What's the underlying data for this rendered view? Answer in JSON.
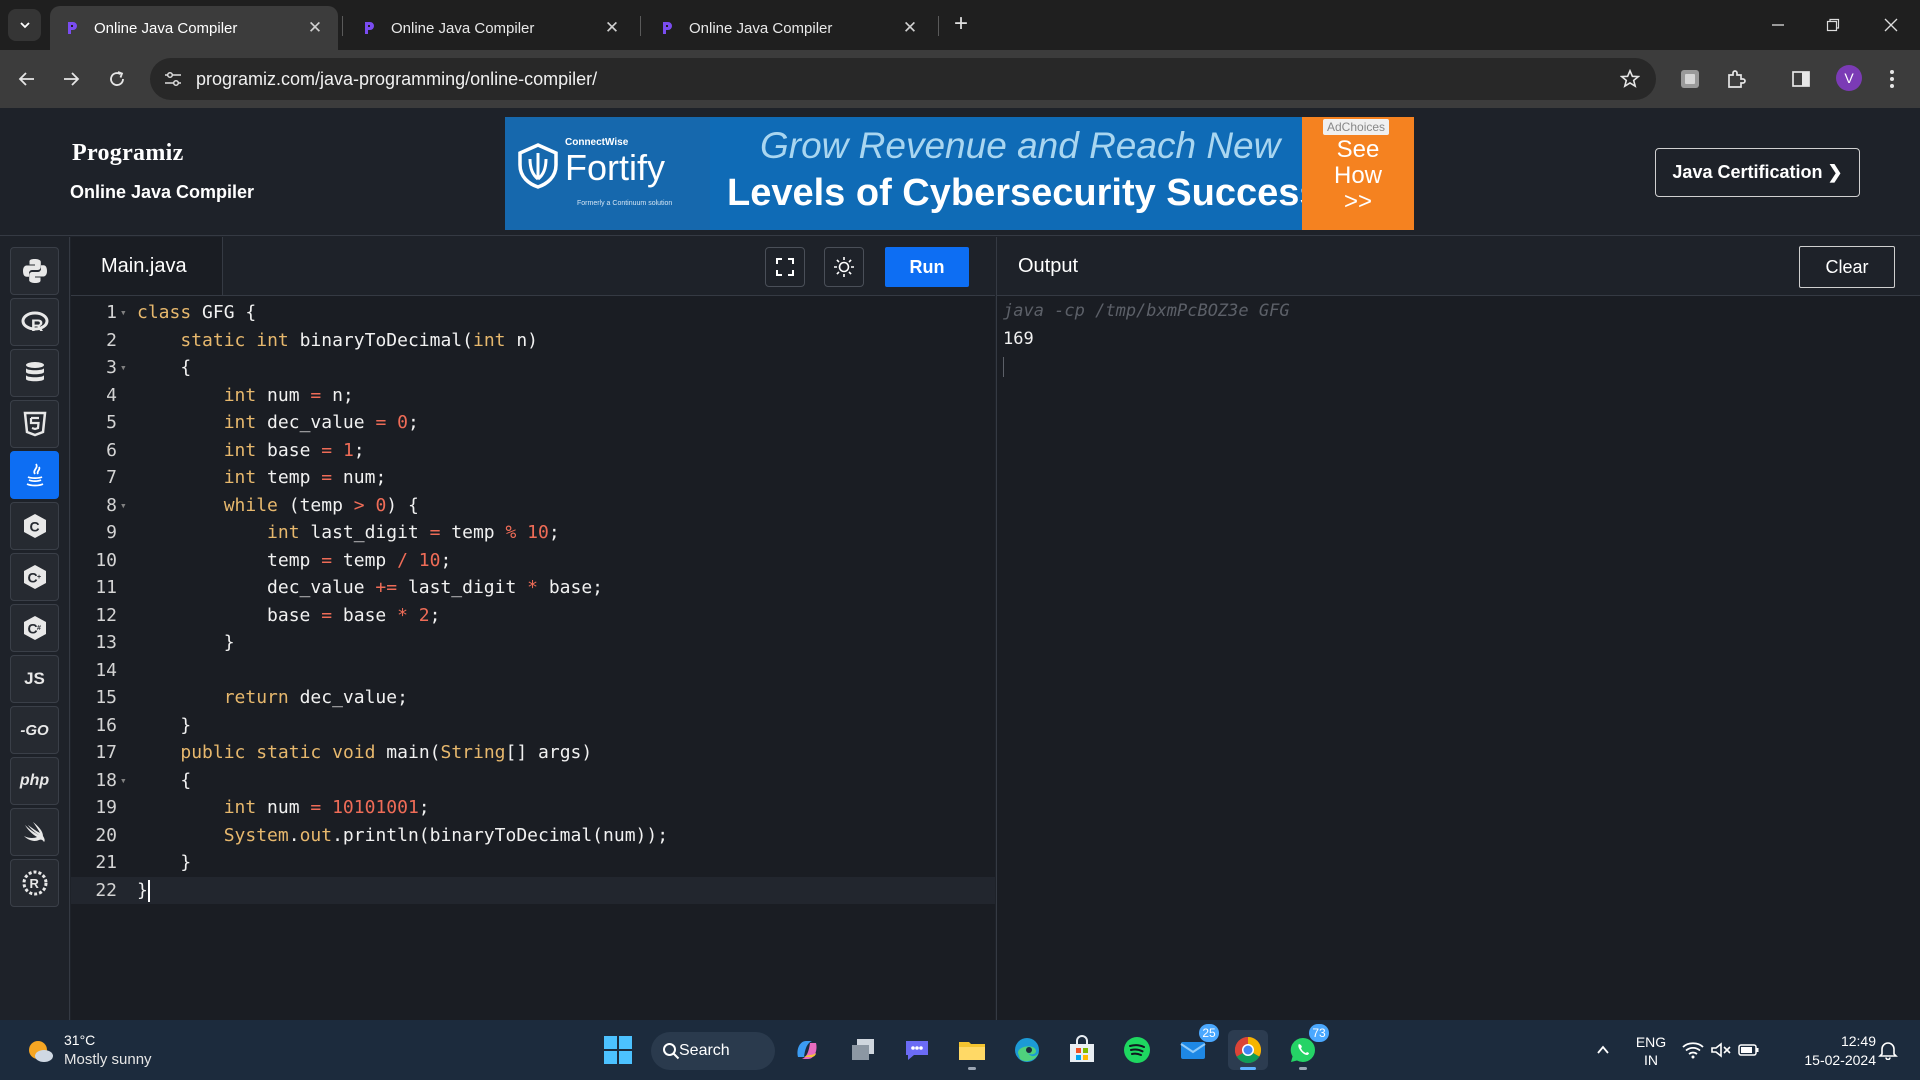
{
  "browser": {
    "tabs": [
      {
        "title": "Online Java Compiler",
        "active": true
      },
      {
        "title": "Online Java Compiler",
        "active": false
      },
      {
        "title": "Online Java Compiler",
        "active": false
      }
    ],
    "url": "programiz.com/java-programming/online-compiler/",
    "profile_initial": "V"
  },
  "header": {
    "logo": "Programiz",
    "subtitle": "Online Java Compiler",
    "cert_button": "Java Certification ❯"
  },
  "ad": {
    "company_small": "ConnectWise",
    "brand": "Fortify",
    "tagline": "Formerly a Continuum solution",
    "line1": "Grow Revenue and Reach New",
    "line2": "Levels of Cybersecurity Success",
    "cta": [
      "See",
      "How",
      ">>"
    ],
    "adchoices": "AdChoices"
  },
  "sidebar": {
    "languages": [
      {
        "name": "python",
        "icon": "python-icon",
        "active": false
      },
      {
        "name": "r",
        "icon": "r-icon",
        "active": false
      },
      {
        "name": "sql",
        "icon": "database-icon",
        "active": false
      },
      {
        "name": "html",
        "icon": "html5-icon",
        "active": false
      },
      {
        "name": "java",
        "icon": "java-icon",
        "active": true
      },
      {
        "name": "c",
        "icon": "c-icon",
        "active": false
      },
      {
        "name": "cpp",
        "icon": "cpp-icon",
        "active": false
      },
      {
        "name": "csharp",
        "icon": "csharp-icon",
        "active": false
      },
      {
        "name": "js",
        "icon": "js-icon",
        "label": "JS",
        "active": false
      },
      {
        "name": "go",
        "icon": "go-icon",
        "label": "-GO",
        "active": false
      },
      {
        "name": "php",
        "icon": "php-icon",
        "label": "php",
        "active": false
      },
      {
        "name": "swift",
        "icon": "swift-icon",
        "active": false
      },
      {
        "name": "rust",
        "icon": "rust-icon",
        "active": false
      }
    ]
  },
  "editor": {
    "filename": "Main.java",
    "run_label": "Run",
    "lines": [
      {
        "n": "1",
        "fold": true,
        "tokens": [
          [
            "kw",
            "class"
          ],
          [
            "t",
            " GFG {"
          ]
        ]
      },
      {
        "n": "2",
        "fold": false,
        "tokens": [
          [
            "t",
            "    "
          ],
          [
            "kw",
            "static"
          ],
          [
            "t",
            " "
          ],
          [
            "kw",
            "int"
          ],
          [
            "t",
            " binaryToDecimal("
          ],
          [
            "kw",
            "int"
          ],
          [
            "t",
            " n)"
          ]
        ]
      },
      {
        "n": "3",
        "fold": true,
        "tokens": [
          [
            "t",
            "    {"
          ]
        ]
      },
      {
        "n": "4",
        "fold": false,
        "tokens": [
          [
            "t",
            "        "
          ],
          [
            "kw",
            "int"
          ],
          [
            "t",
            " num "
          ],
          [
            "op",
            "="
          ],
          [
            "t",
            " n;"
          ]
        ]
      },
      {
        "n": "5",
        "fold": false,
        "tokens": [
          [
            "t",
            "        "
          ],
          [
            "kw",
            "int"
          ],
          [
            "t",
            " dec_value "
          ],
          [
            "op",
            "="
          ],
          [
            "t",
            " "
          ],
          [
            "num",
            "0"
          ],
          [
            "t",
            ";"
          ]
        ]
      },
      {
        "n": "6",
        "fold": false,
        "tokens": [
          [
            "t",
            "        "
          ],
          [
            "kw",
            "int"
          ],
          [
            "t",
            " base "
          ],
          [
            "op",
            "="
          ],
          [
            "t",
            " "
          ],
          [
            "num",
            "1"
          ],
          [
            "t",
            ";"
          ]
        ]
      },
      {
        "n": "7",
        "fold": false,
        "tokens": [
          [
            "t",
            "        "
          ],
          [
            "kw",
            "int"
          ],
          [
            "t",
            " temp "
          ],
          [
            "op",
            "="
          ],
          [
            "t",
            " num;"
          ]
        ]
      },
      {
        "n": "8",
        "fold": true,
        "tokens": [
          [
            "t",
            "        "
          ],
          [
            "kw",
            "while"
          ],
          [
            "t",
            " (temp "
          ],
          [
            "op",
            ">"
          ],
          [
            "t",
            " "
          ],
          [
            "num",
            "0"
          ],
          [
            "t",
            ") {"
          ]
        ]
      },
      {
        "n": "9",
        "fold": false,
        "tokens": [
          [
            "t",
            "            "
          ],
          [
            "kw",
            "int"
          ],
          [
            "t",
            " last_digit "
          ],
          [
            "op",
            "="
          ],
          [
            "t",
            " temp "
          ],
          [
            "op",
            "%"
          ],
          [
            "t",
            " "
          ],
          [
            "num",
            "10"
          ],
          [
            "t",
            ";"
          ]
        ]
      },
      {
        "n": "10",
        "fold": false,
        "tokens": [
          [
            "t",
            "            temp "
          ],
          [
            "op",
            "="
          ],
          [
            "t",
            " temp "
          ],
          [
            "op",
            "/"
          ],
          [
            "t",
            " "
          ],
          [
            "num",
            "10"
          ],
          [
            "t",
            ";"
          ]
        ]
      },
      {
        "n": "11",
        "fold": false,
        "tokens": [
          [
            "t",
            "            dec_value "
          ],
          [
            "op",
            "+="
          ],
          [
            "t",
            " last_digit "
          ],
          [
            "op",
            "*"
          ],
          [
            "t",
            " base;"
          ]
        ]
      },
      {
        "n": "12",
        "fold": false,
        "tokens": [
          [
            "t",
            "            base "
          ],
          [
            "op",
            "="
          ],
          [
            "t",
            " base "
          ],
          [
            "op",
            "*"
          ],
          [
            "t",
            " "
          ],
          [
            "num",
            "2"
          ],
          [
            "t",
            ";"
          ]
        ]
      },
      {
        "n": "13",
        "fold": false,
        "tokens": [
          [
            "t",
            "        }"
          ]
        ]
      },
      {
        "n": "14",
        "fold": false,
        "tokens": [
          [
            "t",
            ""
          ]
        ]
      },
      {
        "n": "15",
        "fold": false,
        "tokens": [
          [
            "t",
            "        "
          ],
          [
            "kw",
            "return"
          ],
          [
            "t",
            " dec_value;"
          ]
        ]
      },
      {
        "n": "16",
        "fold": false,
        "tokens": [
          [
            "t",
            "    }"
          ]
        ]
      },
      {
        "n": "17",
        "fold": false,
        "tokens": [
          [
            "t",
            "    "
          ],
          [
            "kw",
            "public"
          ],
          [
            "t",
            " "
          ],
          [
            "kw",
            "static"
          ],
          [
            "t",
            " "
          ],
          [
            "kw",
            "void"
          ],
          [
            "t",
            " main("
          ],
          [
            "kw",
            "String"
          ],
          [
            "t",
            "[] args)"
          ]
        ]
      },
      {
        "n": "18",
        "fold": true,
        "tokens": [
          [
            "t",
            "    {"
          ]
        ]
      },
      {
        "n": "19",
        "fold": false,
        "tokens": [
          [
            "t",
            "        "
          ],
          [
            "kw",
            "int"
          ],
          [
            "t",
            " num "
          ],
          [
            "op",
            "="
          ],
          [
            "t",
            " "
          ],
          [
            "num",
            "10101001"
          ],
          [
            "t",
            ";"
          ]
        ]
      },
      {
        "n": "20",
        "fold": false,
        "tokens": [
          [
            "t",
            "        "
          ],
          [
            "kw",
            "System"
          ],
          [
            "t",
            "."
          ],
          [
            "kw",
            "out"
          ],
          [
            "t",
            ".println(binaryToDecimal(num));"
          ]
        ]
      },
      {
        "n": "21",
        "fold": false,
        "tokens": [
          [
            "t",
            "    }"
          ]
        ]
      },
      {
        "n": "22",
        "fold": false,
        "current": true,
        "tokens": [
          [
            "t",
            "}"
          ]
        ]
      }
    ]
  },
  "output": {
    "title": "Output",
    "clear_label": "Clear",
    "command": "java -cp /tmp/bxmPcBOZ3e GFG",
    "result": "169"
  },
  "taskbar": {
    "weather_temp": "31°C",
    "weather_desc": "Mostly sunny",
    "search_label": "Search",
    "teams_badge": "25",
    "whatsapp_badge": "73",
    "lang_line1": "ENG",
    "lang_line2": "IN",
    "time": "12:49",
    "date": "15-02-2024"
  },
  "colors": {
    "accent": "#0d6ef3",
    "keyword": "#e7b86d",
    "number": "#ef6c57",
    "editor_bg": "#1a1d23"
  }
}
